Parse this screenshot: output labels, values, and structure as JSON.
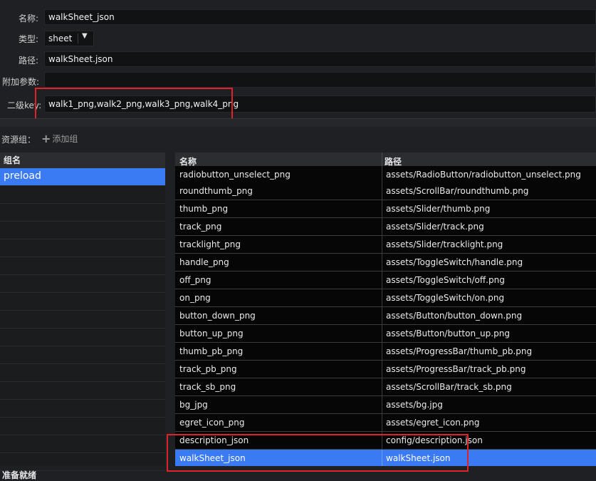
{
  "properties": {
    "name_label": "名称:",
    "name_value": "walkSheet_json",
    "type_label": "类型:",
    "type_value": "sheet",
    "path_label": "路径:",
    "path_value": "walkSheet.json",
    "extra_label": "附加参数:",
    "extra_value": "",
    "subkey_label": "二级key:",
    "subkey_value": "walk1_png,walk2_png,walk3_png,walk4_png"
  },
  "groups": {
    "label": "资源组：",
    "add_label": "添加组",
    "header": "组名",
    "items": [
      "preload"
    ]
  },
  "resources": {
    "col_name": "名称",
    "col_path": "路径",
    "rows": [
      {
        "name": "radiobutton_unselect_png",
        "path": "assets/RadioButton/radiobutton_unselect.png"
      },
      {
        "name": "roundthumb_png",
        "path": "assets/ScrollBar/roundthumb.png"
      },
      {
        "name": "thumb_png",
        "path": "assets/Slider/thumb.png"
      },
      {
        "name": "track_png",
        "path": "assets/Slider/track.png"
      },
      {
        "name": "tracklight_png",
        "path": "assets/Slider/tracklight.png"
      },
      {
        "name": "handle_png",
        "path": "assets/ToggleSwitch/handle.png"
      },
      {
        "name": "off_png",
        "path": "assets/ToggleSwitch/off.png"
      },
      {
        "name": "on_png",
        "path": "assets/ToggleSwitch/on.png"
      },
      {
        "name": "button_down_png",
        "path": "assets/Button/button_down.png"
      },
      {
        "name": "button_up_png",
        "path": "assets/Button/button_up.png"
      },
      {
        "name": "thumb_pb_png",
        "path": "assets/ProgressBar/thumb_pb.png"
      },
      {
        "name": "track_pb_png",
        "path": "assets/ProgressBar/track_pb.png"
      },
      {
        "name": "track_sb_png",
        "path": "assets/ScrollBar/track_sb.png"
      },
      {
        "name": "bg_jpg",
        "path": "assets/bg.jpg"
      },
      {
        "name": "egret_icon_png",
        "path": "assets/egret_icon.png"
      },
      {
        "name": "description_json",
        "path": "config/description.json"
      },
      {
        "name": "walkSheet_json",
        "path": "walkSheet.json"
      }
    ]
  },
  "status": "准备就绪",
  "colors": {
    "accent": "#3a7af2",
    "highlight_box": "#e02328"
  }
}
